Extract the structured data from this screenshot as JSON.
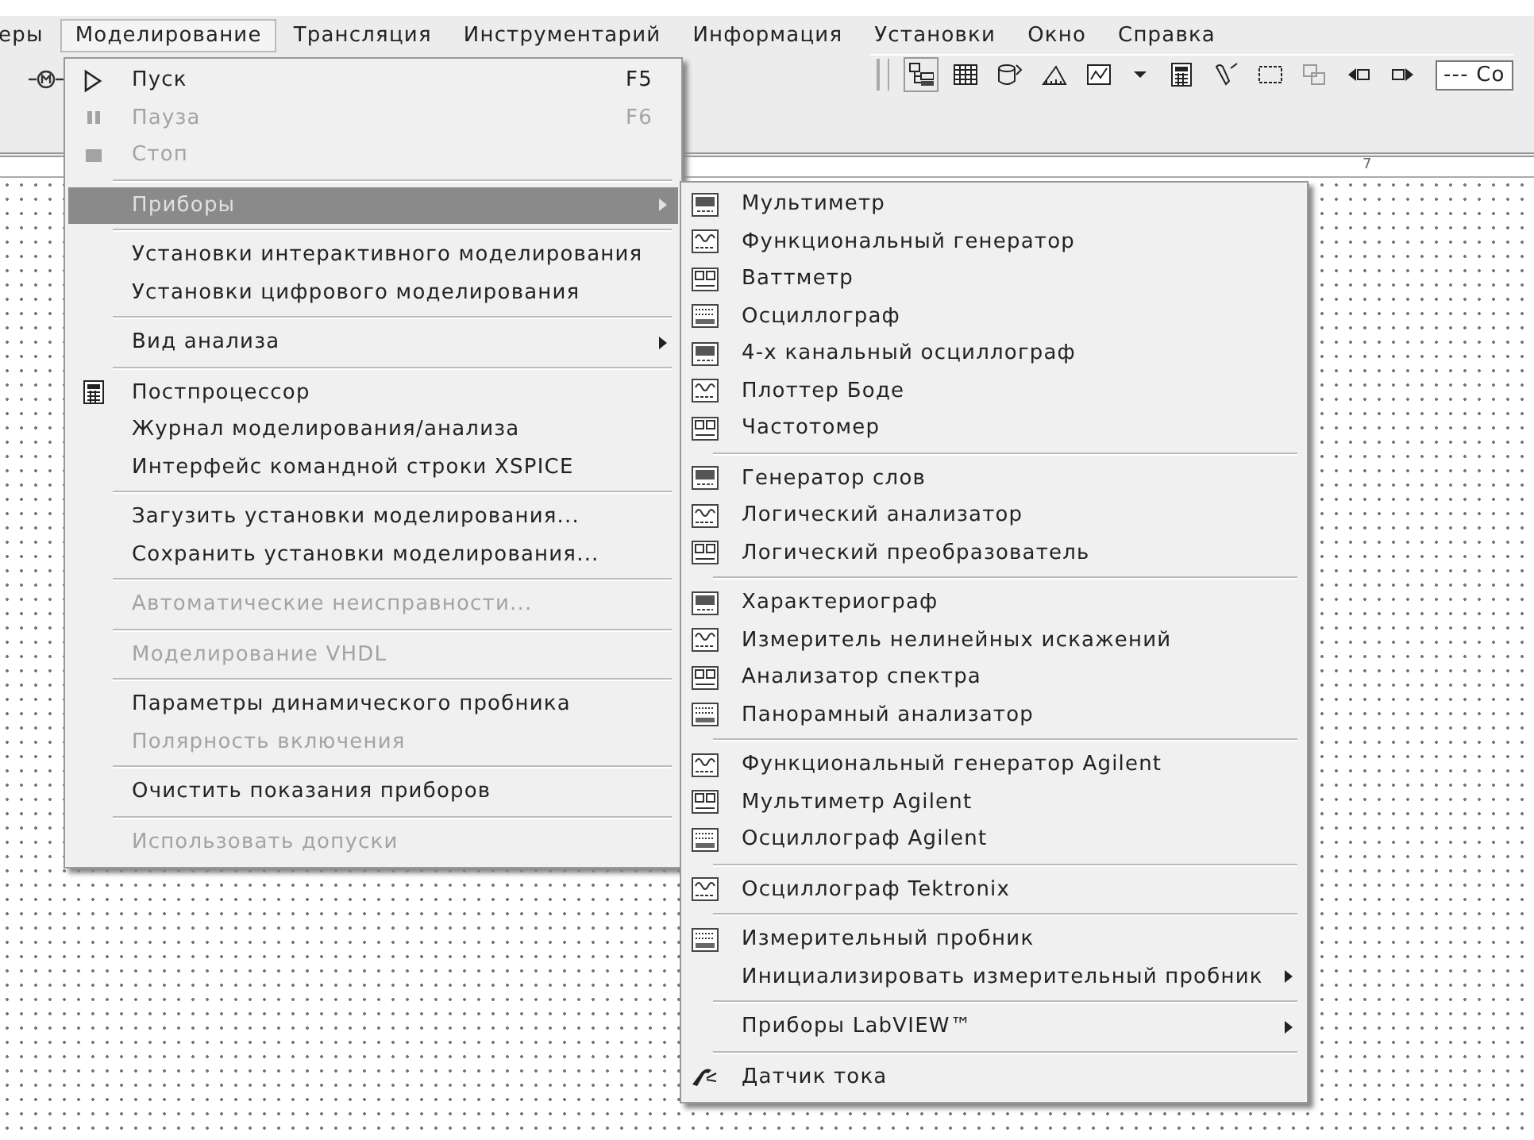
{
  "menubar": [
    {
      "label": "еры",
      "selected": false
    },
    {
      "label": "Моделирование",
      "selected": true
    },
    {
      "label": "Трансляция",
      "selected": false
    },
    {
      "label": "Инструментарий",
      "selected": false
    },
    {
      "label": "Информация",
      "selected": false
    },
    {
      "label": "Установки",
      "selected": false
    },
    {
      "label": "Окно",
      "selected": false
    },
    {
      "label": "Справка",
      "selected": false
    }
  ],
  "toolbar": {
    "combo_value": "--- Co"
  },
  "ruler": {
    "labels": [
      "7"
    ]
  },
  "menu": {
    "items": [
      {
        "kind": "item",
        "label": "Пуск",
        "shortcut": "F5",
        "icon": true,
        "disabled": false,
        "selected": false,
        "submenu": false
      },
      {
        "kind": "item",
        "label": "Пауза",
        "shortcut": "F6",
        "icon": true,
        "disabled": true,
        "selected": false,
        "submenu": false
      },
      {
        "kind": "item",
        "label": "Стоп",
        "icon": true,
        "disabled": true,
        "selected": false,
        "submenu": false
      },
      {
        "kind": "separator"
      },
      {
        "kind": "item",
        "label": "Приборы",
        "icon": false,
        "disabled": false,
        "selected": true,
        "submenu": true
      },
      {
        "kind": "separator"
      },
      {
        "kind": "item",
        "label": "Установки интерактивного моделирования",
        "icon": false,
        "disabled": false,
        "selected": false,
        "submenu": false
      },
      {
        "kind": "item",
        "label": "Установки цифрового моделирования",
        "icon": false,
        "disabled": false,
        "selected": false,
        "submenu": false
      },
      {
        "kind": "separator"
      },
      {
        "kind": "item",
        "label": "Вид анализа",
        "icon": false,
        "disabled": false,
        "selected": false,
        "submenu": true
      },
      {
        "kind": "separator"
      },
      {
        "kind": "item",
        "label": "Постпроцессор",
        "icon": true,
        "disabled": false,
        "selected": false,
        "submenu": false
      },
      {
        "kind": "item",
        "label": "Журнал моделирования/анализа",
        "icon": false,
        "disabled": false,
        "selected": false,
        "submenu": false
      },
      {
        "kind": "item",
        "label": "Интерфейс командной строки XSPICE",
        "icon": false,
        "disabled": false,
        "selected": false,
        "submenu": false
      },
      {
        "kind": "separator"
      },
      {
        "kind": "item",
        "label": "Загузить установки моделирования...",
        "icon": false,
        "disabled": false,
        "selected": false,
        "submenu": false
      },
      {
        "kind": "item",
        "label": "Сохранить установки моделирования...",
        "icon": false,
        "disabled": false,
        "selected": false,
        "submenu": false
      },
      {
        "kind": "separator"
      },
      {
        "kind": "item",
        "label": "Автоматические неисправности...",
        "icon": false,
        "disabled": true,
        "selected": false,
        "submenu": false
      },
      {
        "kind": "separator"
      },
      {
        "kind": "item",
        "label": "Моделирование VHDL",
        "icon": false,
        "disabled": true,
        "selected": false,
        "submenu": false
      },
      {
        "kind": "separator"
      },
      {
        "kind": "item",
        "label": "Параметры динамического пробника",
        "icon": false,
        "disabled": false,
        "selected": false,
        "submenu": false
      },
      {
        "kind": "item",
        "label": "Полярность включения",
        "icon": false,
        "disabled": true,
        "selected": false,
        "submenu": false
      },
      {
        "kind": "separator"
      },
      {
        "kind": "item",
        "label": "Очистить показания приборов",
        "icon": false,
        "disabled": false,
        "selected": false,
        "submenu": false
      },
      {
        "kind": "separator"
      },
      {
        "kind": "item",
        "label": "Использовать допуски",
        "icon": false,
        "disabled": true,
        "selected": false,
        "submenu": false
      }
    ]
  },
  "submenu": {
    "items": [
      {
        "kind": "item",
        "label": "Мультиметр",
        "icon": true,
        "submenu": false
      },
      {
        "kind": "item",
        "label": "Функциональный генератор",
        "icon": true,
        "submenu": false
      },
      {
        "kind": "item",
        "label": "Ваттметр",
        "icon": true,
        "submenu": false
      },
      {
        "kind": "item",
        "label": "Осциллограф",
        "icon": true,
        "submenu": false
      },
      {
        "kind": "item",
        "label": "4-х канальный осциллограф",
        "icon": true,
        "submenu": false
      },
      {
        "kind": "item",
        "label": "Плоттер Боде",
        "icon": true,
        "submenu": false
      },
      {
        "kind": "item",
        "label": "Частотомер",
        "icon": true,
        "submenu": false
      },
      {
        "kind": "separator"
      },
      {
        "kind": "item",
        "label": "Генератор слов",
        "icon": true,
        "submenu": false
      },
      {
        "kind": "item",
        "label": "Логический анализатор",
        "icon": true,
        "submenu": false
      },
      {
        "kind": "item",
        "label": "Логический преобразователь",
        "icon": true,
        "submenu": false
      },
      {
        "kind": "separator"
      },
      {
        "kind": "item",
        "label": "Характериограф",
        "icon": true,
        "submenu": false
      },
      {
        "kind": "item",
        "label": "Измеритель нелинейных искажений",
        "icon": true,
        "submenu": false
      },
      {
        "kind": "item",
        "label": "Анализатор спектра",
        "icon": true,
        "submenu": false
      },
      {
        "kind": "item",
        "label": "Панорамный анализатор",
        "icon": true,
        "submenu": false
      },
      {
        "kind": "separator"
      },
      {
        "kind": "item",
        "label": "Функциональный генератор Agilent",
        "icon": true,
        "submenu": false
      },
      {
        "kind": "item",
        "label": "Мультиметр Agilent",
        "icon": true,
        "submenu": false
      },
      {
        "kind": "item",
        "label": "Осциллограф Agilent",
        "icon": true,
        "submenu": false
      },
      {
        "kind": "separator"
      },
      {
        "kind": "item",
        "label": "Осциллограф Tektronix",
        "icon": true,
        "submenu": false
      },
      {
        "kind": "separator"
      },
      {
        "kind": "item",
        "label": "Измерительный пробник",
        "icon": true,
        "submenu": false
      },
      {
        "kind": "item",
        "label": "Инициализировать измерительный пробник",
        "icon": false,
        "submenu": true
      },
      {
        "kind": "separator"
      },
      {
        "kind": "item",
        "label": "Приборы LabVIEW™",
        "icon": false,
        "submenu": true
      },
      {
        "kind": "separator"
      },
      {
        "kind": "item",
        "label": "Датчик тока",
        "icon": true,
        "submenu": false
      }
    ]
  }
}
